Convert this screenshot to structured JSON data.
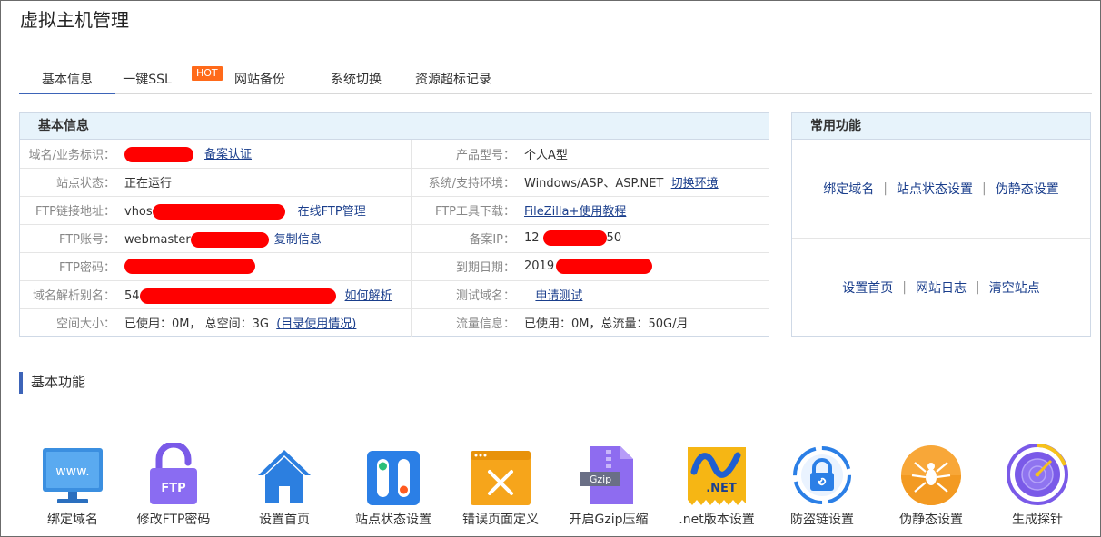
{
  "page": {
    "title": "虚拟主机管理"
  },
  "tabs": [
    {
      "label": "基本信息",
      "active": true
    },
    {
      "label": "一键SSL",
      "badge": "HOT"
    },
    {
      "label": "网站备份"
    },
    {
      "label": "系统切换"
    },
    {
      "label": "资源超标记录"
    }
  ],
  "basic_info": {
    "title": "基本信息",
    "rows": [
      {
        "l_label": "域名/业务标识：",
        "l_link": "备案认证",
        "r_label": "产品型号：",
        "r_value": "个人A型"
      },
      {
        "l_label": "站点状态：",
        "l_value": "正在运行",
        "r_label": "系统/支持环境：",
        "r_value": "Windows/ASP、ASP.NET",
        "r_link": "切换环境"
      },
      {
        "l_label": "FTP链接地址：",
        "l_value": "vhos",
        "l_link": "在线FTP管理",
        "r_label": "FTP工具下载：",
        "r_link": "FileZilla+使用教程"
      },
      {
        "l_label": "FTP账号：",
        "l_value": "webmaster",
        "l_link": "复制信息",
        "r_label": "备案IP：",
        "r_value": "12",
        "r_value_suffix": "50"
      },
      {
        "l_label": "FTP密码：",
        "r_label": "到期日期：",
        "r_value": "2019"
      },
      {
        "l_label": "域名解析别名：",
        "l_value": "54",
        "l_link": "如何解析",
        "r_label": "测试域名：",
        "r_link": "申请测试"
      },
      {
        "l_label": "空间大小：",
        "l_value": "已使用：0M， 总空间：3G",
        "l_link": "(目录使用情况)",
        "r_label": "流量信息：",
        "r_value": "已使用：0M，总流量：50G/月"
      }
    ]
  },
  "common_functions": {
    "title": "常用功能",
    "row1": [
      "绑定域名",
      "站点状态设置",
      "伪静态设置"
    ],
    "row2": [
      "设置首页",
      "网站日志",
      "清空站点"
    ],
    "separator": "|"
  },
  "basic_functions": {
    "title": "基本功能",
    "items": [
      {
        "label": "绑定域名",
        "icon": "www-monitor-icon",
        "icon_text": "www."
      },
      {
        "label": "修改FTP密码",
        "icon": "ftp-lock-icon",
        "icon_text": "FTP"
      },
      {
        "label": "设置首页",
        "icon": "home-icon"
      },
      {
        "label": "站点状态设置",
        "icon": "toggle-status-icon"
      },
      {
        "label": "错误页面定义",
        "icon": "error-page-icon"
      },
      {
        "label": "开启Gzip压缩",
        "icon": "gzip-file-icon",
        "icon_text": "Gzip"
      },
      {
        "label": ".net版本设置",
        "icon": "dotnet-icon",
        "icon_text": ".NET"
      },
      {
        "label": "防盗链设置",
        "icon": "anti-leech-lock-icon"
      },
      {
        "label": "伪静态设置",
        "icon": "spider-icon"
      },
      {
        "label": "生成探针",
        "icon": "probe-radar-icon"
      }
    ]
  },
  "colors": {
    "accent": "#3d64b8",
    "hot_badge": "#ff6a1a",
    "panel_header": "#e7f3fb",
    "link": "#1a3e8c",
    "redaction": "#ff0000"
  }
}
